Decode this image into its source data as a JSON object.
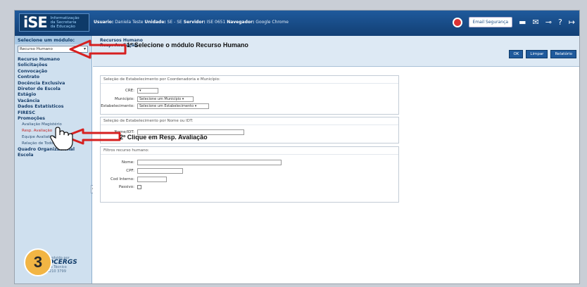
{
  "header": {
    "logo_mark": "iSE",
    "logo_text": [
      "Informatização",
      "da Secretaria",
      "da Educação"
    ],
    "user_info": {
      "usuario_label": "Usuario:",
      "usuario_value": "Daniela Teste",
      "unidade_label": "Unidade:",
      "unidade_value": "SE - SE",
      "servidor_label": "Servidor:",
      "servidor_value": "ISE 0651",
      "navegador_label": "Navegador:",
      "navegador_value": "Google Chrome"
    },
    "email_seguranca": "Email Segurança"
  },
  "sidebar": {
    "module_heading": "Selecione um módulo:",
    "module_selected": "Recurso Humano",
    "menu": [
      "Recurso Humano",
      "Solicitações",
      "Convocação",
      "Contrato",
      "Docência Exclusiva",
      "Diretor de Escola",
      "Estágio",
      "Vacância",
      "Dados Estatísticos",
      "FIRESC",
      "Promoções"
    ],
    "submenu": [
      "Avaliação Magistério",
      "Resp. Avaliação",
      "Equipe Avaliativa",
      "Relação de Todos"
    ],
    "menu_after": "Quadro Organizacional Escola",
    "footer_lines": [
      "Desenvolvido por",
      "PROCERGS",
      "Suporte Técnico",
      "(51) 3210 3799"
    ],
    "step_number": "3"
  },
  "content": {
    "crumb_line1": "Recursos Humano",
    "crumb_line2": "Resp. Avaliação",
    "buttons": [
      "OK",
      "Limpar",
      "Relatório"
    ],
    "box1": {
      "title": "Seleção de Estabelecimento por Coordenadoria e Município:",
      "cre_label": "CRE:",
      "cre_value": "",
      "municipio_label": "Município:",
      "municipio_value": "Selecione um Município",
      "estab_label": "Estabelecimento:",
      "estab_value": "Selecione um Estabelecimento"
    },
    "box2": {
      "title": "Seleção de Estabelecimento por Nome ou IDT:",
      "nome_label": "Nome/IDT:"
    },
    "box3": {
      "title": "Filtros recurso humano:",
      "nome_label": "Nome:",
      "cpf_label": "CPF:",
      "cod_label": "Cod Interno:",
      "passivo_label": "Passivo:"
    }
  },
  "annotations": {
    "step1": "1º Selecione o módulo Recurso Humano",
    "step2": "2º Clique em Resp. Avaliação",
    "arrow_color": "#d62020"
  }
}
